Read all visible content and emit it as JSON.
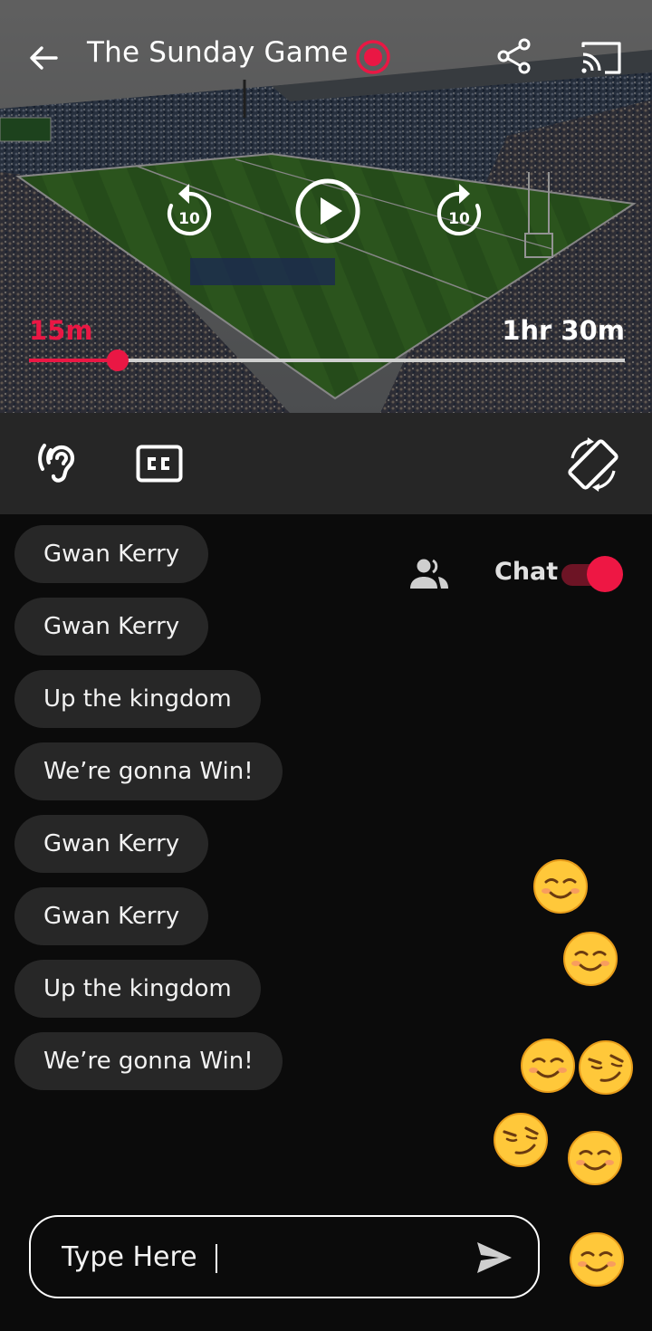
{
  "header": {
    "title": "The Sunday Game",
    "live_icon": "live-record-icon",
    "back_icon": "arrow-back-icon",
    "share_icon": "share-icon",
    "cast_icon": "cast-icon"
  },
  "player": {
    "rewind_icon": "replay-10-icon",
    "rewind_seconds": "10",
    "play_icon": "play-circle-icon",
    "forward_icon": "forward-10-icon",
    "forward_seconds": "10",
    "elapsed": "15m",
    "duration": "1hr 30m",
    "progress_fraction": 0.149,
    "accent_color": "#ea1744"
  },
  "controls": {
    "hearing_icon": "hearing-icon",
    "cc_icon": "closed-captions-icon",
    "rotate_icon": "screen-rotation-icon"
  },
  "chat": {
    "viewers_icon": "people-icon",
    "toggle_label": "Chat",
    "toggle_on": true,
    "messages": [
      "Gwan Kerry",
      "Gwan Kerry",
      "Up the kingdom",
      "We’re gonna Win!",
      "Gwan Kerry",
      "Gwan Kerry",
      "Up the kingdom",
      "We’re gonna Win!"
    ],
    "reactions": [
      "☺️",
      "☺️",
      "☺️",
      "😏",
      "😏",
      "☺️"
    ],
    "input_placeholder": "Type Here",
    "send_icon": "send-icon",
    "emoji_button": "☺️"
  }
}
